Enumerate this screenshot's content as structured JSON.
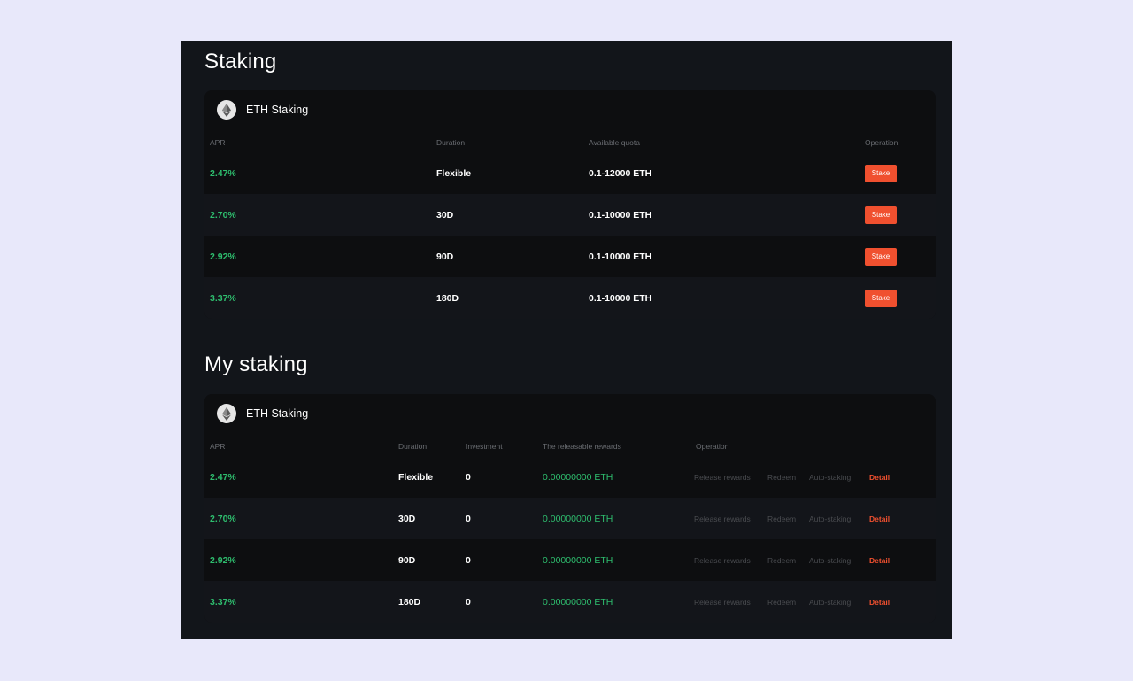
{
  "staking": {
    "title": "Staking",
    "card_name": "ETH Staking",
    "coin_icon": "ethereum-icon",
    "columns": {
      "apr": "APR",
      "duration": "Duration",
      "quota": "Available quota",
      "operation": "Operation"
    },
    "rows": [
      {
        "apr": "2.47%",
        "duration": "Flexible",
        "quota": "0.1-12000 ETH",
        "button": "Stake"
      },
      {
        "apr": "2.70%",
        "duration": "30D",
        "quota": "0.1-10000 ETH",
        "button": "Stake"
      },
      {
        "apr": "2.92%",
        "duration": "90D",
        "quota": "0.1-10000 ETH",
        "button": "Stake"
      },
      {
        "apr": "3.37%",
        "duration": "180D",
        "quota": "0.1-10000 ETH",
        "button": "Stake"
      }
    ]
  },
  "my_staking": {
    "title": "My staking",
    "card_name": "ETH Staking",
    "coin_icon": "ethereum-icon",
    "columns": {
      "apr": "APR",
      "duration": "Duration",
      "investment": "Investment",
      "rewards": "The releasable rewards",
      "operation": "Operation"
    },
    "rows": [
      {
        "apr": "2.47%",
        "duration": "Flexible",
        "investment": "0",
        "rewards": "0.00000000 ETH",
        "release": "Release rewards",
        "redeem": "Redeem",
        "auto": "Auto-staking",
        "detail": "Detail"
      },
      {
        "apr": "2.70%",
        "duration": "30D",
        "investment": "0",
        "rewards": "0.00000000 ETH",
        "release": "Release rewards",
        "redeem": "Redeem",
        "auto": "Auto-staking",
        "detail": "Detail"
      },
      {
        "apr": "2.92%",
        "duration": "90D",
        "investment": "0",
        "rewards": "0.00000000 ETH",
        "release": "Release rewards",
        "redeem": "Redeem",
        "auto": "Auto-staking",
        "detail": "Detail"
      },
      {
        "apr": "3.37%",
        "duration": "180D",
        "investment": "0",
        "rewards": "0.00000000 ETH",
        "release": "Release rewards",
        "redeem": "Redeem",
        "auto": "Auto-staking",
        "detail": "Detail"
      }
    ]
  },
  "colors": {
    "background": "#e8e8fa",
    "panel": "#12151a",
    "accent_green": "#2ebd6e",
    "accent_orange": "#f0502f"
  }
}
